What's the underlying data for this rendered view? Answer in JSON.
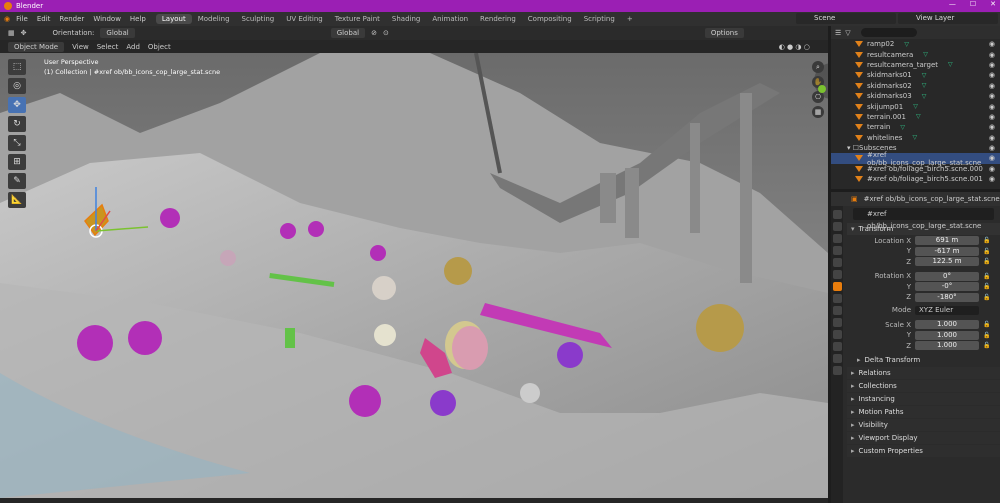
{
  "app": {
    "title": "Blender",
    "window_controls": [
      "—",
      "☐",
      "✕"
    ]
  },
  "menu": [
    "File",
    "Edit",
    "Render",
    "Window",
    "Help"
  ],
  "workspace_tabs": [
    "Layout",
    "Modeling",
    "Sculpting",
    "UV Editing",
    "Texture Paint",
    "Shading",
    "Animation",
    "Rendering",
    "Compositing",
    "Scripting",
    "+"
  ],
  "active_workspace": "Layout",
  "scene": "Scene",
  "view_layer": "View Layer",
  "viewport_header": {
    "orientation_label": "Orientation:",
    "orientation_value": "Global",
    "transform_space": "Global",
    "options": "Options"
  },
  "viewport_header2": {
    "mode": "Object Mode",
    "menus": [
      "View",
      "Select",
      "Add",
      "Object"
    ]
  },
  "viewport_info": {
    "line1": "User Perspective",
    "line2": "(1) Collection | #xref ob/bb_icons_cop_large_stat.scne"
  },
  "outliner": {
    "rows": [
      {
        "name": "ramp02",
        "selected": false
      },
      {
        "name": "resultcamera",
        "selected": false
      },
      {
        "name": "resultcamera_target",
        "selected": false
      },
      {
        "name": "skidmarks01",
        "selected": false
      },
      {
        "name": "skidmarks02",
        "selected": false
      },
      {
        "name": "skidmarks03",
        "selected": false
      },
      {
        "name": "skijump01",
        "selected": false
      },
      {
        "name": "terrain.001",
        "selected": false
      },
      {
        "name": "terrain",
        "selected": false
      },
      {
        "name": "whitelines",
        "selected": false
      },
      {
        "name": "Subscenes",
        "selected": false,
        "collection": true
      },
      {
        "name": "#xref ob/bb_icons_cop_large_stat.scne",
        "selected": true
      },
      {
        "name": "#xref ob/foliage_birch5.scne.000",
        "selected": false
      },
      {
        "name": "#xref ob/foliage_birch5.scne.001",
        "selected": false
      }
    ]
  },
  "properties": {
    "header_object": "#xref ob/bb_icons_cop_large_stat.scne",
    "object_name": "#xref ob/bb_icons_cop_large_stat.scne",
    "transform_label": "Transform",
    "location": {
      "label": "Location X",
      "x": "691 m",
      "y": "-617 m",
      "z": "122.5 m"
    },
    "rotation": {
      "label": "Rotation X",
      "x": "0°",
      "y": "-0°",
      "z": "-180°"
    },
    "mode_label": "Mode",
    "mode_value": "XYZ Euler",
    "scale": {
      "label": "Scale X",
      "x": "1.000",
      "y": "1.000",
      "z": "1.000"
    },
    "axis_y": "Y",
    "axis_z": "Z",
    "delta": "Delta Transform",
    "sections": [
      "Relations",
      "Collections",
      "Instancing",
      "Motion Paths",
      "Visibility",
      "Viewport Display",
      "Custom Properties"
    ]
  },
  "colors": {
    "titlebar": "#9b1fb4",
    "accent": "#4772b3",
    "selection": "#334d80",
    "object_orange": "#e87d0d"
  }
}
